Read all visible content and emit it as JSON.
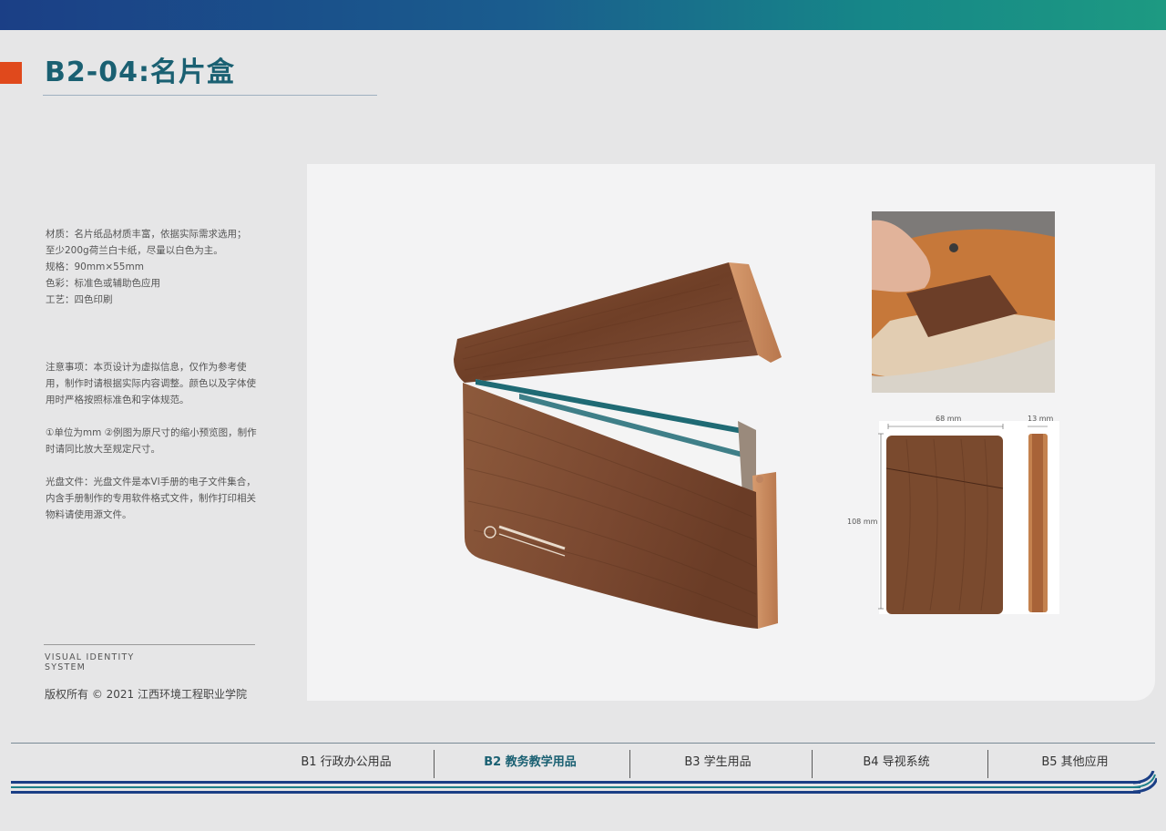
{
  "header": {
    "title": "B2-04:名片盒"
  },
  "specs": [
    "材质：名片纸品材质丰富，依据实际需求选用；",
    "至少200g荷兰白卡纸，尽量以白色为主。",
    "规格：90mm×55mm",
    "色彩：标准色或辅助色应用",
    "工艺：四色印刷"
  ],
  "notes": [
    "注意事项：本页设计为虚拟信息，仅作为参考使用，制作时请根据实际内容调整。颜色以及字体使用时严格按照标准色和字体规范。",
    "①单位为mm  ②例图为原尺寸的缩小预览图，制作时请同比放大至规定尺寸。",
    "光盘文件：光盘文件是本VI手册的电子文件集合，内含手册制作的专用软件格式文件，制作打印相关物料请使用源文件。"
  ],
  "footer": {
    "visual_identity_line1": "VISUAL IDENTITY",
    "visual_identity_line2": "SYSTEM",
    "copyright": "版权所有  ©  2021   江西环境工程职业学院"
  },
  "dimensions": {
    "width": "68 mm",
    "depth": "13 mm",
    "height": "108 mm"
  },
  "nav": {
    "items": [
      {
        "label": "B1 行政办公用品",
        "active": false
      },
      {
        "label": "B2 教务教学用品",
        "active": true
      },
      {
        "label": "B3 学生用品",
        "active": false
      },
      {
        "label": "B4 导视系统",
        "active": false
      },
      {
        "label": "B5 其他应用",
        "active": false
      }
    ]
  },
  "colors": {
    "brand_blue": "#1b3f86",
    "brand_teal": "#1d7f88",
    "accent_orange": "#e0491c",
    "title_teal": "#1a6072",
    "wood": "#7a4a30"
  }
}
